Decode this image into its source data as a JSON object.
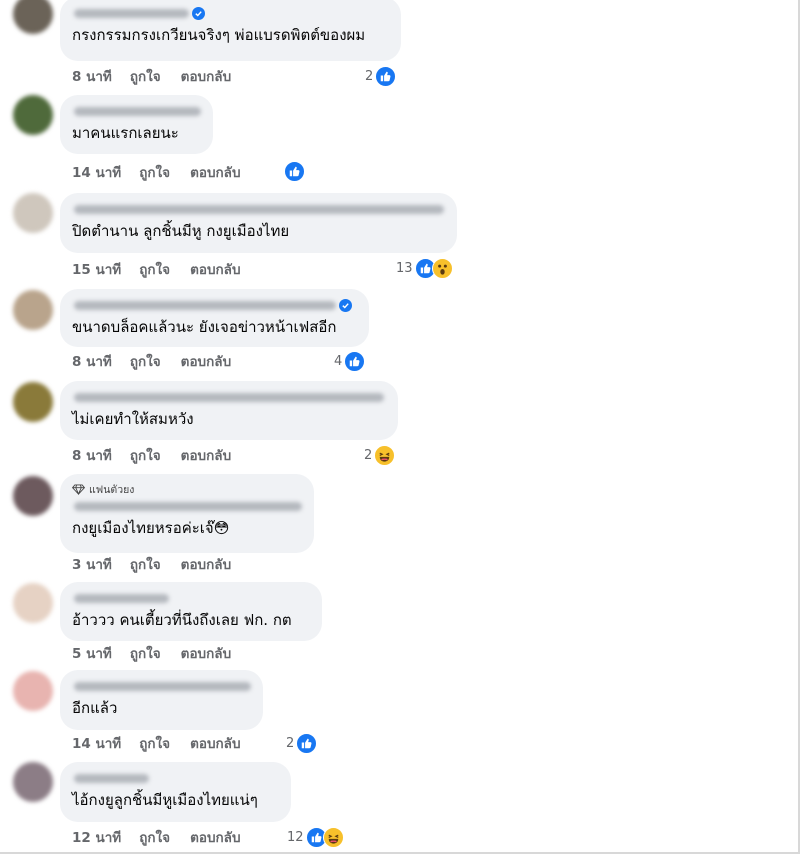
{
  "actions": {
    "like": "ถูกใจ",
    "reply": "ตอบกลับ"
  },
  "fan_badge": {
    "label": "แฟนตัวยง"
  },
  "colors": {
    "like_blue": "#1877f2",
    "bubble": "#f0f2f5",
    "meta_gray": "#65676b"
  },
  "comments": [
    {
      "text": "กรงกรรมกรงเกวียนจริงๆ พ่อแบรดพิตต์ของผม",
      "time": "8 นาที",
      "reaction_count": "2",
      "reactions": [
        "like-icon"
      ],
      "verified": true
    },
    {
      "text": "มาคนแรกเลยนะ",
      "time": "14 นาที",
      "reaction_count": "",
      "reactions": [
        "like-icon"
      ],
      "verified": false
    },
    {
      "text": "ปิดตำนาน ลูกชิ้นมีหู กงยูเมืองไทย",
      "time": "15 นาที",
      "reaction_count": "13",
      "reactions": [
        "like-icon",
        "wow-icon"
      ],
      "verified": false
    },
    {
      "text": "ขนาดบล็อคแล้วนะ ยังเจอข่าวหน้าเฟสอีก",
      "time": "8 นาที",
      "reaction_count": "4",
      "reactions": [
        "like-icon"
      ],
      "verified": true
    },
    {
      "text": "ไม่เคยทำให้สมหวัง",
      "time": "8 นาที",
      "reaction_count": "2",
      "reactions": [
        "haha-icon"
      ],
      "verified": false
    },
    {
      "text": "กงยูเมืองไทยหรอค่ะเจ๊😳",
      "time": "3 นาที",
      "reaction_count": "",
      "reactions": [],
      "verified": false,
      "fan": true
    },
    {
      "text": "อ้าววว คนเตี้ยวที่นึงถึงเลย ฟก. กต",
      "time": "5 นาที",
      "reaction_count": "",
      "reactions": [],
      "verified": false
    },
    {
      "text": "อีกแล้ว",
      "time": "14 นาที",
      "reaction_count": "2",
      "reactions": [
        "like-icon"
      ],
      "verified": false
    },
    {
      "text": "ไอ้กงยูลูกชิ้นมีหูเมืองไทยแน่ๆ",
      "time": "12 นาที",
      "reaction_count": "12",
      "reactions": [
        "like-icon",
        "haha-icon"
      ],
      "verified": false
    }
  ]
}
